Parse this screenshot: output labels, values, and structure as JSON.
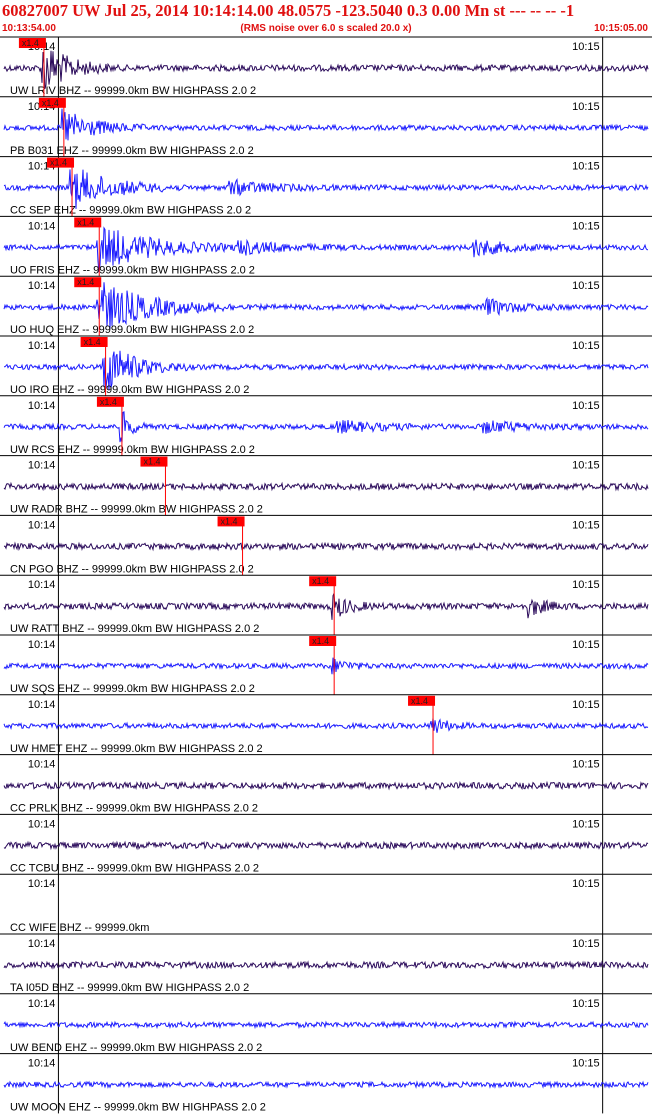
{
  "header": {
    "title": "60827007 UW Jul 25, 2014 10:14:14.00   48.0575 -123.5040  0.3 0.00 Mn st --- -- --  -1",
    "start_time": "10:13:54.00",
    "subtitle": "(RMS noise over 6.0 s scaled 20.0 x)",
    "end_time": "10:15:05.00"
  },
  "colors": {
    "header_red": "#e01010",
    "pick_red": "#ff0000",
    "blue": "#1a1aff",
    "purple": "#2a0a5a"
  },
  "chart_data": {
    "type": "line",
    "title": "60827007 UW Jul 25, 2014 10:14:14.00   48.0575 -123.5040  0.3 0.00 Mn st --- -- --  -1",
    "time_range": [
      "10:13:54.00",
      "10:15:05.00"
    ],
    "tick_labels": [
      "10:14",
      "10:15"
    ],
    "pick_label": "x1.4",
    "grid": true,
    "series": [
      {
        "name": "UW LRIV BHZ -- 99999.0km BW  HIGHPASS  2.0  2",
        "color": "purple",
        "pick": "10:13:58.4",
        "events": [
          {
            "t": "10:13:58.4",
            "amp": 1.0,
            "dur": 2.5
          }
        ]
      },
      {
        "name": "PB B031 EHZ -- 99999.0km BW  HIGHPASS  2.0  2",
        "color": "blue",
        "pick": "10:14:00.6",
        "events": [
          {
            "t": "10:14:00.6",
            "amp": 0.7,
            "dur": 3
          }
        ]
      },
      {
        "name": "CC SEP EHZ -- 99999.0km BW  HIGHPASS  2.0  2",
        "color": "blue",
        "pick": "10:14:01.5",
        "events": [
          {
            "t": "10:14:01.5",
            "amp": 0.8,
            "dur": 4
          },
          {
            "t": "10:14:19",
            "amp": 0.25,
            "dur": 4
          }
        ]
      },
      {
        "name": "UO FRIS EHZ -- 99999.0km BW  HIGHPASS  2.0  2",
        "color": "blue",
        "pick": "10:14:04.5",
        "events": [
          {
            "t": "10:14:04.5",
            "amp": 0.9,
            "dur": 5
          },
          {
            "t": "10:14:20",
            "amp": 0.25,
            "dur": 4
          },
          {
            "t": "10:14:46",
            "amp": 0.3,
            "dur": 3
          }
        ]
      },
      {
        "name": "UO HUQ EHZ -- 99999.0km BW  HIGHPASS  2.0  2",
        "color": "blue",
        "pick": "10:14:04.5",
        "events": [
          {
            "t": "10:14:04.5",
            "amp": 1.0,
            "dur": 5
          },
          {
            "t": "10:14:47",
            "amp": 0.3,
            "dur": 3
          }
        ]
      },
      {
        "name": "UO IRO EHZ -- 99999.0km BW  HIGHPASS  2.0  2",
        "color": "blue",
        "pick": "10:14:05.2",
        "events": [
          {
            "t": "10:14:05.2",
            "amp": 1.0,
            "dur": 3
          }
        ]
      },
      {
        "name": "UW RCS EHZ -- 99999.0km BW  HIGHPASS  2.0  2",
        "color": "blue",
        "pick": "10:14:07.0",
        "events": [
          {
            "t": "10:14:07.0",
            "amp": 0.6,
            "dur": 1
          },
          {
            "t": "10:14:31",
            "amp": 0.2,
            "dur": 4
          },
          {
            "t": "10:14:47",
            "amp": 0.2,
            "dur": 4
          }
        ]
      },
      {
        "name": "UW RADR BHZ -- 99999.0km BW  HIGHPASS  2.0  2",
        "color": "purple",
        "pick": "10:14:11.8",
        "events": []
      },
      {
        "name": "CN PGO BHZ -- 99999.0km BW  HIGHPASS  2.0  2",
        "color": "purple",
        "pick": "10:14:20.3",
        "events": []
      },
      {
        "name": "UW RATT BHZ -- 99999.0km BW  HIGHPASS  2.0  2",
        "color": "purple",
        "pick": "10:14:30.4",
        "events": [
          {
            "t": "10:14:30.4",
            "amp": 0.45,
            "dur": 1.5
          },
          {
            "t": "10:14:52",
            "amp": 0.35,
            "dur": 1.5
          }
        ]
      },
      {
        "name": "UW SQS EHZ -- 99999.0km BW  HIGHPASS  2.0  2",
        "color": "blue",
        "pick": "10:14:30.4",
        "events": [
          {
            "t": "10:14:30.4",
            "amp": 0.25,
            "dur": 1.5
          }
        ]
      },
      {
        "name": "UW HMET EHZ -- 99999.0km BW  HIGHPASS  2.0  2",
        "color": "blue",
        "pick": "10:14:41.3",
        "events": [
          {
            "t": "10:14:41.3",
            "amp": 0.3,
            "dur": 1.5
          }
        ]
      },
      {
        "name": "CC PRLK BHZ -- 99999.0km BW  HIGHPASS  2.0  2",
        "color": "purple",
        "pick": null,
        "events": []
      },
      {
        "name": "CC TCBU BHZ -- 99999.0km BW  HIGHPASS  2.0  2",
        "color": "purple",
        "pick": null,
        "events": []
      },
      {
        "name": "CC WIFE BHZ -- 99999.0km",
        "color": "none",
        "pick": null,
        "events": []
      },
      {
        "name": "TA I05D BHZ -- 99999.0km BW  HIGHPASS  2.0  2",
        "color": "purple",
        "pick": null,
        "events": []
      },
      {
        "name": "UW BEND EHZ -- 99999.0km BW  HIGHPASS  2.0  2",
        "color": "blue",
        "pick": null,
        "events": []
      },
      {
        "name": "UW MOON EHZ -- 99999.0km BW  HIGHPASS  2.0  2",
        "color": "blue",
        "pick": null,
        "events": []
      }
    ]
  }
}
